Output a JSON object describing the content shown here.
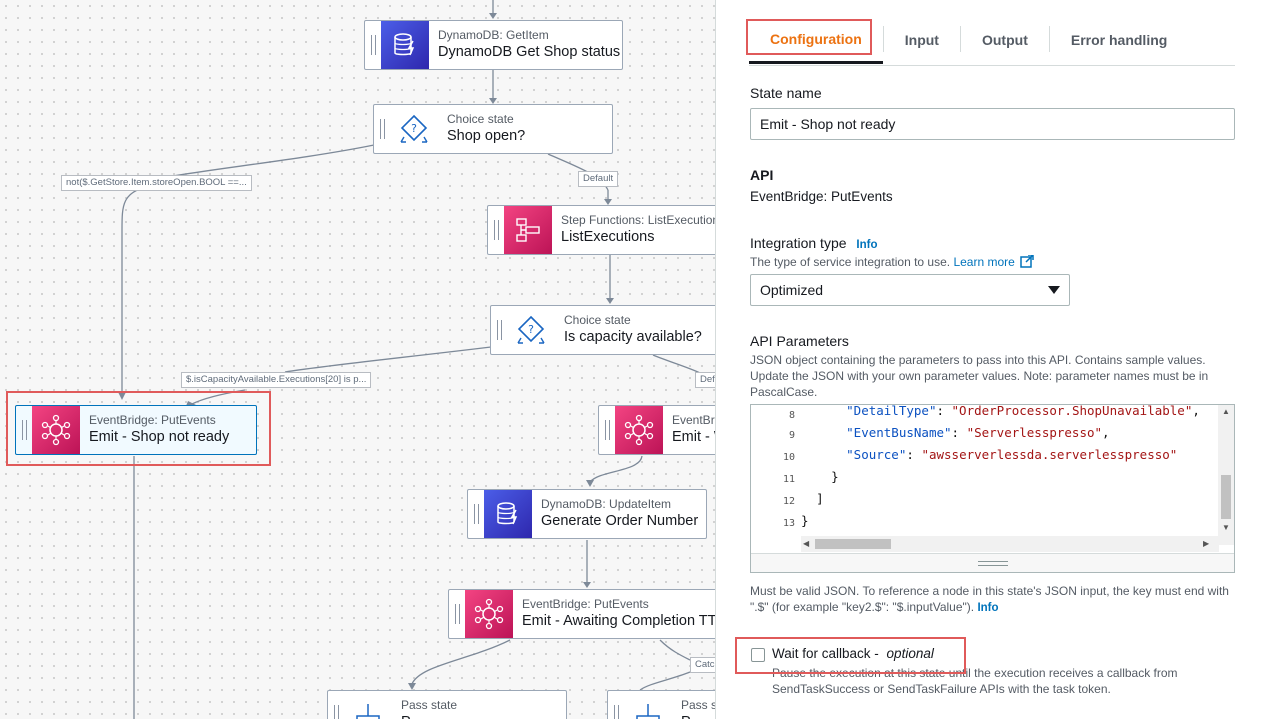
{
  "workflow": {
    "nodes": {
      "get_shop": {
        "type": "DynamoDB: GetItem",
        "name": "DynamoDB Get Shop status"
      },
      "shop_open": {
        "type": "Choice state",
        "name": "Shop open?"
      },
      "list_exec": {
        "type": "Step Functions: ListExecution",
        "name": "ListExecutions"
      },
      "capacity": {
        "type": "Choice state",
        "name": "Is capacity available?"
      },
      "emit_not_ready": {
        "type": "EventBridge: PutEvents",
        "name": "Emit - Shop not ready"
      },
      "emit_right": {
        "type": "EventBri",
        "name": "Emit - W"
      },
      "gen_order": {
        "type": "DynamoDB: UpdateItem",
        "name": "Generate Order Number"
      },
      "emit_awaiting": {
        "type": "EventBridge: PutEvents",
        "name": "Emit - Awaiting Completion TT"
      },
      "pass1": {
        "type": "Pass state",
        "name": "P"
      },
      "pass2": {
        "type": "Pass st",
        "name": "P"
      }
    },
    "edge_labels": {
      "not_open": "not($.GetStore.Item.storeOpen.BOOL ==...",
      "default1": "Default",
      "capacity_cond": "$.isCapacityAvailable.Executions[20] is p...",
      "default2": "Def",
      "catch": "Catc"
    }
  },
  "panel": {
    "tabs": [
      "Configuration",
      "Input",
      "Output",
      "Error handling"
    ],
    "state_name_label": "State name",
    "state_name_value": "Emit - Shop not ready",
    "api_label": "API",
    "api_value": "EventBridge: PutEvents",
    "integration_label": "Integration type",
    "info": "Info",
    "integration_desc": "The type of service integration to use.",
    "learn_more": "Learn more",
    "integration_value": "Optimized",
    "api_params_label": "API Parameters",
    "api_params_desc1": "JSON object containing the parameters to pass into this API. Contains sample values.",
    "api_params_desc2": "Update the JSON with your own parameter values. Note: parameter names must be in",
    "api_params_desc3": "PascalCase.",
    "code": {
      "line_numbers": [
        "8",
        "9",
        "10",
        "11",
        "12",
        "13"
      ],
      "detail_key": "\"DetailType\"",
      "detail_val": "\"OrderProcessor.ShopUnavailable\"",
      "bus_key": "\"EventBusName\"",
      "bus_val": "\"Serverlesspresso\"",
      "source_key": "\"Source\"",
      "source_val": "\"awsserverlessda.serverlesspresso\"",
      "close1": "}",
      "close2": "]",
      "close3": "}"
    },
    "json_note1": "Must be valid JSON. To reference a node in this state's JSON input, the key must end with",
    "json_note2": "\".$\" (for example \"key2.$\": \"$.inputValue\").",
    "callback_label": "Wait for callback -",
    "callback_optional": "optional",
    "callback_desc1": "Pause the execution at this state until the execution receives a callback from",
    "callback_desc2": "SendTaskSuccess or SendTaskFailure APIs with the task token."
  },
  "colors": {
    "accent": "#ec7211",
    "link": "#0073bb",
    "highlight": "#e05a5a",
    "selected_border": "#0073bb"
  }
}
